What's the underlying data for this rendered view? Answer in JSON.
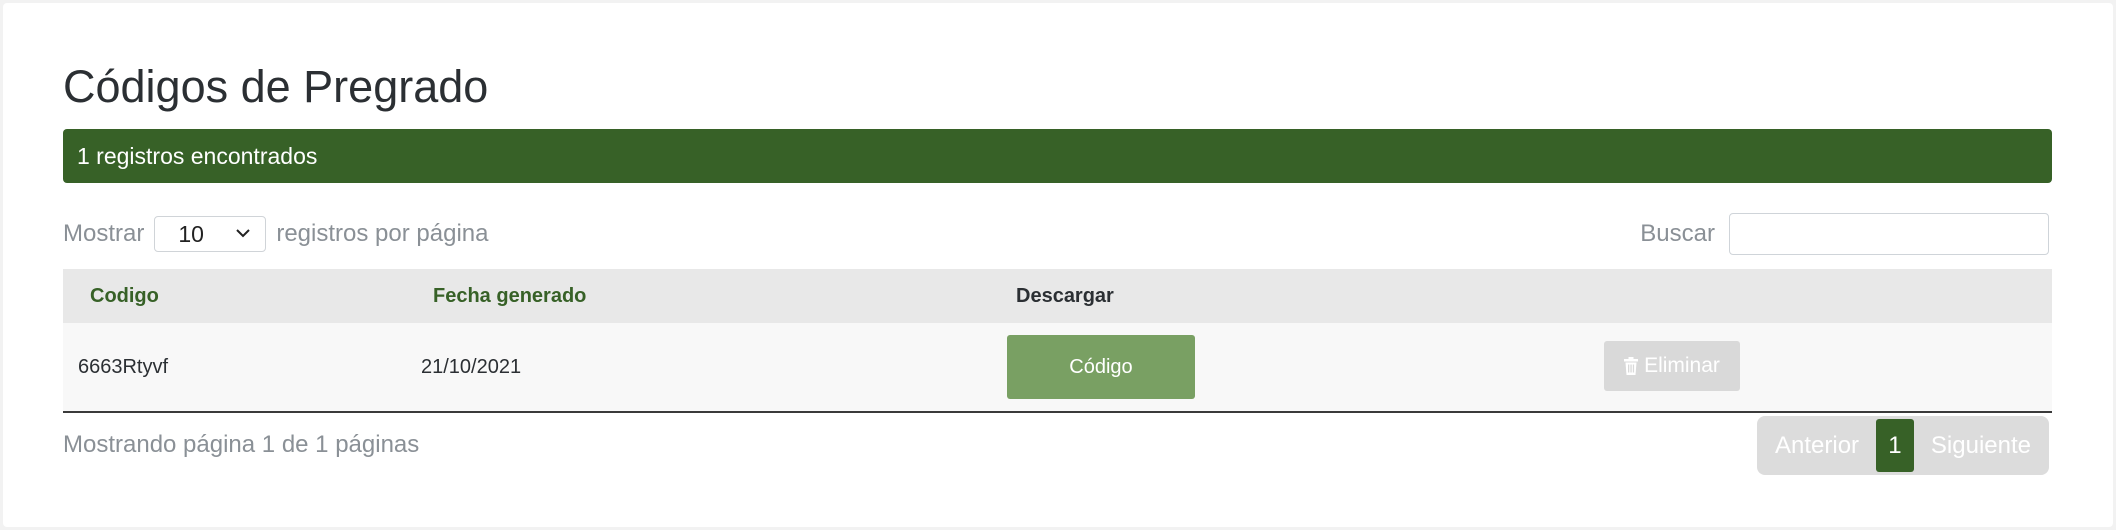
{
  "page": {
    "title": "Códigos de Pregrado",
    "records_found": "1 registros encontrados"
  },
  "controls": {
    "show_label": "Mostrar",
    "page_size": "10",
    "per_page_label": "registros por página",
    "search_label": "Buscar",
    "search_value": ""
  },
  "table": {
    "headers": {
      "codigo": "Codigo",
      "fecha": "Fecha generado",
      "descargar": "Descargar"
    },
    "rows": [
      {
        "codigo": "6663Rtyvf",
        "fecha": "21/10/2021",
        "download_label": "Código",
        "delete_label": "Eliminar"
      }
    ]
  },
  "footer": {
    "info": "Mostrando página 1 de 1 páginas",
    "prev_label": "Anterior",
    "current_page": "1",
    "next_label": "Siguiente"
  },
  "colors": {
    "brand_green": "#376127",
    "download_button": "#79a063",
    "disabled_button": "#d9d9d9"
  },
  "icons": {
    "delete": "trash-icon",
    "select": "chevron-down-icon"
  }
}
